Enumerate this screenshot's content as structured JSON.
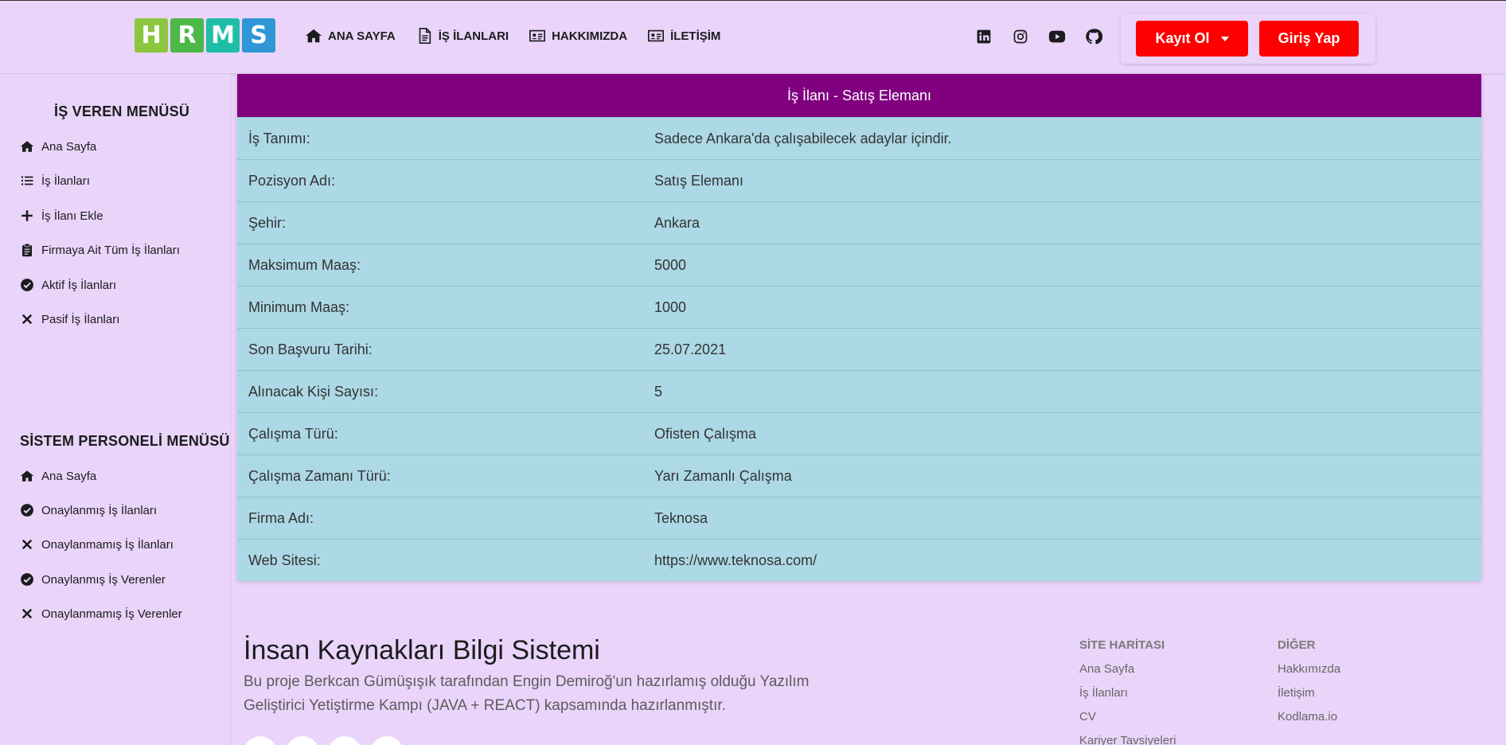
{
  "header": {
    "logo_letters": [
      "H",
      "R",
      "M",
      "S"
    ],
    "logo_colors": [
      "#8cc63f",
      "#4cb848",
      "#1fbfa7",
      "#2f97d6"
    ],
    "nav": [
      {
        "label": "ANA SAYFA",
        "icon": "home-icon"
      },
      {
        "label": "İŞ İLANLARI",
        "icon": "document-icon"
      },
      {
        "label": "HAKKIMIZDA",
        "icon": "id-card-icon"
      },
      {
        "label": "İLETİŞİM",
        "icon": "id-card-icon"
      }
    ],
    "social": [
      "linkedin-icon",
      "instagram-icon",
      "youtube-icon",
      "github-icon"
    ],
    "register_label": "Kayıt Ol",
    "login_label": "Giriş Yap",
    "accent_color": "#ff0000"
  },
  "sidebar": {
    "employer_title": "İŞ VEREN MENÜSÜ",
    "employer_items": [
      {
        "label": "Ana Sayfa",
        "icon": "home-icon"
      },
      {
        "label": "İş İlanları",
        "icon": "list-icon"
      },
      {
        "label": "İş İlanı Ekle",
        "icon": "plus-icon"
      },
      {
        "label": "Firmaya Ait Tüm İş İlanları",
        "icon": "clipboard-icon"
      },
      {
        "label": "Aktif İş İlanları",
        "icon": "check-circle-icon"
      },
      {
        "label": "Pasif İş İlanları",
        "icon": "x-icon"
      }
    ],
    "staff_title": "SİSTEM PERSONELİ MENÜSÜ",
    "staff_items": [
      {
        "label": "Ana Sayfa",
        "icon": "home-icon"
      },
      {
        "label": "Onaylanmış İş İlanları",
        "icon": "check-circle-icon"
      },
      {
        "label": "Onaylanmamış İş İlanları",
        "icon": "x-icon"
      },
      {
        "label": "Onaylanmış İş Verenler",
        "icon": "check-circle-icon"
      },
      {
        "label": "Onaylanmamış İş Verenler",
        "icon": "x-icon"
      }
    ]
  },
  "job": {
    "title": "İş İlanı - Satış Elemanı",
    "header_color": "#800080",
    "row_color": "#add8e6",
    "rows": [
      {
        "label": "İş Tanımı:",
        "value": "Sadece Ankara'da çalışabilecek adaylar içindir."
      },
      {
        "label": "Pozisyon Adı:",
        "value": "Satış Elemanı"
      },
      {
        "label": "Şehir:",
        "value": "Ankara"
      },
      {
        "label": "Maksimum Maaş:",
        "value": "5000"
      },
      {
        "label": "Minimum Maaş:",
        "value": "1000"
      },
      {
        "label": "Son Başvuru Tarihi:",
        "value": "25.07.2021"
      },
      {
        "label": "Alınacak Kişi Sayısı:",
        "value": "5"
      },
      {
        "label": "Çalışma Türü:",
        "value": "Ofisten Çalışma"
      },
      {
        "label": "Çalışma Zamanı Türü:",
        "value": "Yarı Zamanlı Çalışma"
      },
      {
        "label": "Firma Adı:",
        "value": "Teknosa"
      },
      {
        "label": "Web Sitesi:",
        "value": "https://www.teknosa.com/"
      }
    ]
  },
  "footer": {
    "title": "İnsan Kaynakları Bilgi Sistemi",
    "description": "Bu proje Berkcan Gümüşışık tarafından Engin Demiroğ'un hazırlamış olduğu Yazılım Geliştirici Yetiştirme Kampı (JAVA + REACT) kapsamında hazırlanmıştır.",
    "sitemap_title": "SİTE HARİTASI",
    "sitemap_links": [
      "Ana Sayfa",
      "İş İlanları",
      "CV",
      "Kariyer Tavsiyeleri"
    ],
    "other_title": "DİĞER",
    "other_links": [
      "Hakkımızda",
      "İletişim",
      "Kodlama.io"
    ]
  }
}
